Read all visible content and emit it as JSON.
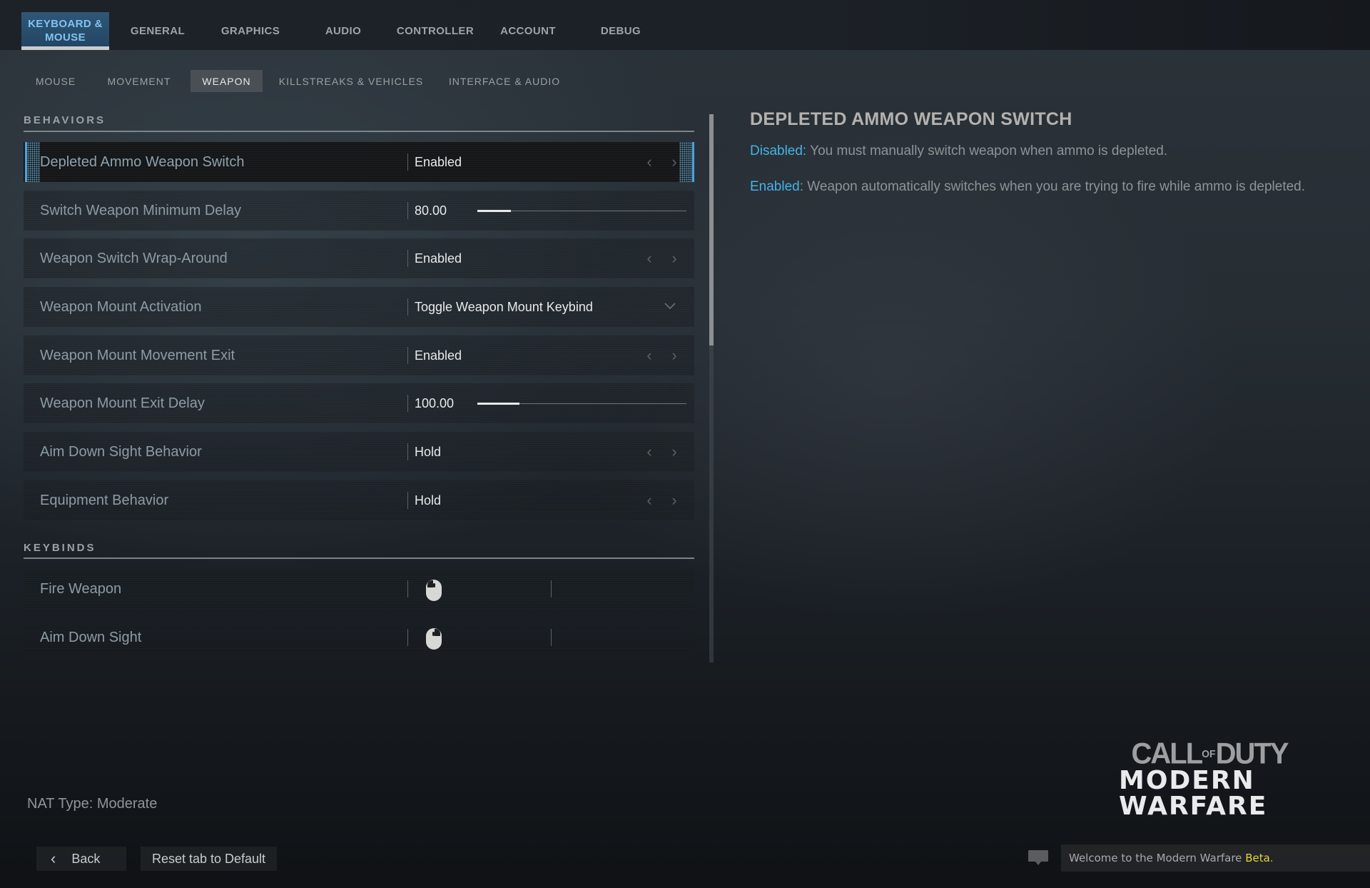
{
  "top_tabs": [
    {
      "label": "KEYBOARD &\nMOUSE",
      "active": true
    },
    {
      "label": "GENERAL"
    },
    {
      "label": "GRAPHICS"
    },
    {
      "label": "AUDIO"
    },
    {
      "label": "CONTROLLER"
    },
    {
      "label": "ACCOUNT"
    },
    {
      "label": "DEBUG"
    }
  ],
  "sub_tabs": [
    {
      "label": "MOUSE"
    },
    {
      "label": "MOVEMENT"
    },
    {
      "label": "WEAPON",
      "active": true
    },
    {
      "label": "KILLSTREAKS & VEHICLES"
    },
    {
      "label": "INTERFACE & AUDIO"
    }
  ],
  "behaviors": {
    "title": "BEHAVIORS",
    "rows": [
      {
        "label": "Depleted Ammo Weapon Switch",
        "type": "toggle",
        "value": "Enabled",
        "selected": true
      },
      {
        "label": "Switch Weapon Minimum Delay",
        "type": "slider",
        "value": "80.00",
        "fill_percent": 16
      },
      {
        "label": "Weapon Switch Wrap-Around",
        "type": "toggle",
        "value": "Enabled"
      },
      {
        "label": "Weapon Mount Activation",
        "type": "dropdown",
        "value": "Toggle Weapon Mount Keybind"
      },
      {
        "label": "Weapon Mount Movement Exit",
        "type": "toggle",
        "value": "Enabled"
      },
      {
        "label": "Weapon Mount Exit Delay",
        "type": "slider",
        "value": "100.00",
        "fill_percent": 20
      },
      {
        "label": "Aim Down Sight Behavior",
        "type": "toggle",
        "value": "Hold"
      },
      {
        "label": "Equipment Behavior",
        "type": "toggle",
        "value": "Hold"
      }
    ]
  },
  "keybinds": {
    "title": "KEYBINDS",
    "rows": [
      {
        "label": "Fire Weapon",
        "primary_icon": "mouse-left-click-icon"
      },
      {
        "label": "Aim Down Sight",
        "primary_icon": "mouse-right-click-icon"
      }
    ]
  },
  "detail": {
    "title": "DEPLETED AMMO WEAPON SWITCH",
    "disabled_label": "Disabled:",
    "disabled_text": " You must manually switch weapon when ammo is depleted.",
    "enabled_label": "Enabled",
    "enabled_text": ": Weapon automatically switches when you are trying to fire while ammo is depleted."
  },
  "footer": {
    "nat_type": "NAT Type: Moderate",
    "back_label": "Back",
    "reset_label": "Reset tab to Default",
    "message_prefix": "Welcome to the Modern Warfare ",
    "message_highlight": "Beta",
    "message_suffix": "."
  },
  "logo": {
    "line1_a": "CALL",
    "line1_of": "OF",
    "line1_b": "DUTY",
    "line2": "MODERN",
    "line3": "WARFARE"
  },
  "colors": {
    "accent_blue": "#45b2e6",
    "active_tab_bg": "#2f5777",
    "beta_yellow": "#e6d53a"
  }
}
